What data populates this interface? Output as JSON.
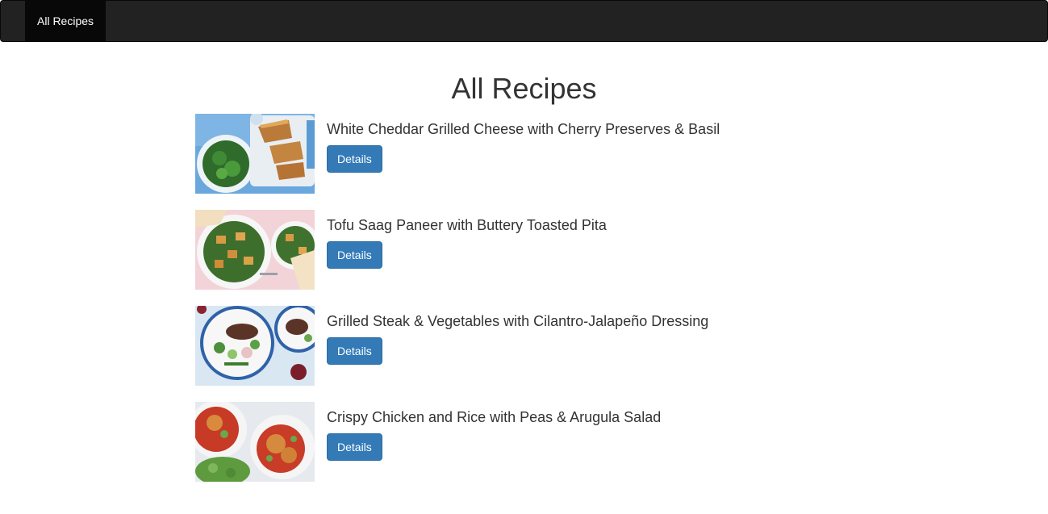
{
  "navbar": {
    "items": [
      {
        "label": "All Recipes",
        "active": true
      }
    ]
  },
  "page": {
    "title": "All Recipes"
  },
  "recipes": [
    {
      "title": "White Cheddar Grilled Cheese with Cherry Preserves & Basil",
      "button": "Details"
    },
    {
      "title": "Tofu Saag Paneer with Buttery Toasted Pita",
      "button": "Details"
    },
    {
      "title": "Grilled Steak & Vegetables with Cilantro-Jalapeño Dressing",
      "button": "Details"
    },
    {
      "title": "Crispy Chicken and Rice with Peas & Arugula Salad",
      "button": "Details"
    }
  ],
  "colors": {
    "navbar_bg": "#222222",
    "navbar_active": "#080808",
    "primary_button": "#337ab7",
    "text": "#333333"
  }
}
